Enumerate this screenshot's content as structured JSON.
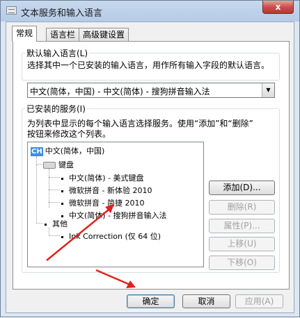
{
  "window": {
    "title": "文本服务和输入语言",
    "close_label": "x"
  },
  "tabs": [
    {
      "label": "常规",
      "active": true
    },
    {
      "label": "语言栏",
      "active": false
    },
    {
      "label": "高级键设置",
      "active": false
    }
  ],
  "default_language": {
    "group_label": "默认输入语言(L)",
    "description": "选择其中一个已安装的输入语言，用作所有输入字段的默认语言。",
    "selected_value": "中文(简体，中国) - 中文(简体) - 搜狗拼音输入法"
  },
  "installed_services": {
    "group_label": "已安装的服务(I)",
    "description_line1": "为列表中显示的每个输入语言选择服务。使用“添加”和“删除”",
    "description_line2": "按钮来修改这个列表。",
    "tree": {
      "language_badge": "CH",
      "language": "中文(简体，中国)",
      "keyboard_group": "键盘",
      "keyboards": [
        "中文(简体) - 美式键盘",
        "微软拼音 - 新体验 2010",
        "微软拼音 - 简捷 2010",
        "中文(简体) - 搜狗拼音输入法"
      ],
      "other_group": "其他",
      "others": [
        "Ink Correction (仅 64 位)"
      ]
    },
    "buttons": {
      "add": "添加(D)...",
      "remove": "删除(R)",
      "properties": "属性(P)...",
      "move_up": "上移(U)",
      "move_down": "下移(O)"
    }
  },
  "footer": {
    "ok": "确定",
    "cancel": "取消",
    "apply": "应用(A)"
  },
  "annotation": {
    "arrow_color": "#e0221c"
  }
}
